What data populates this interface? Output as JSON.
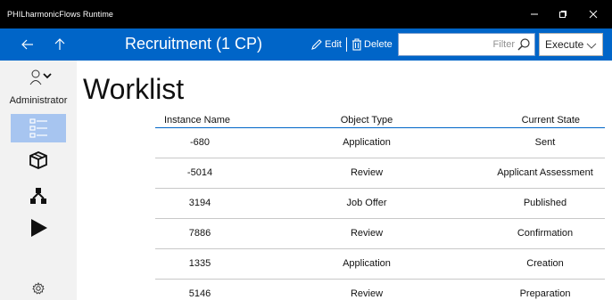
{
  "window": {
    "title": "PHILharmonicFlows Runtime",
    "minimize_icon": "minimize-icon",
    "maximize_icon": "maximize-icon",
    "close_icon": "close-icon"
  },
  "header": {
    "back_icon": "back-arrow-icon",
    "up_icon": "up-arrow-icon",
    "title": "Recruitment (1 CP)",
    "edit_label": "Edit",
    "delete_label": "Delete",
    "filter": {
      "value": "",
      "placeholder": "Filter"
    },
    "execute": {
      "selected": "Execute"
    },
    "accent_color": "#0065c8"
  },
  "sidebar": {
    "user": {
      "role": "Administrator"
    },
    "items": [
      {
        "name": "worklist",
        "icon": "list-icon",
        "active": true
      },
      {
        "name": "objects",
        "icon": "cube-icon",
        "active": false
      },
      {
        "name": "relations",
        "icon": "hierarchy-icon",
        "active": false
      },
      {
        "name": "run",
        "icon": "play-icon",
        "active": false
      }
    ],
    "settings_icon": "gear-icon",
    "active_color": "#a7c5f0"
  },
  "main": {
    "title": "Worklist",
    "columns": [
      "Instance Name",
      "Object Type",
      "Current State"
    ],
    "rows": [
      {
        "name": "-680",
        "type": "Application",
        "state": "Sent"
      },
      {
        "name": "-5014",
        "type": "Review",
        "state": "Applicant Assessment"
      },
      {
        "name": "3194",
        "type": "Job Offer",
        "state": "Published"
      },
      {
        "name": "7886",
        "type": "Review",
        "state": "Confirmation"
      },
      {
        "name": "1335",
        "type": "Application",
        "state": "Creation"
      },
      {
        "name": "5146",
        "type": "Review",
        "state": "Preparation"
      }
    ]
  }
}
